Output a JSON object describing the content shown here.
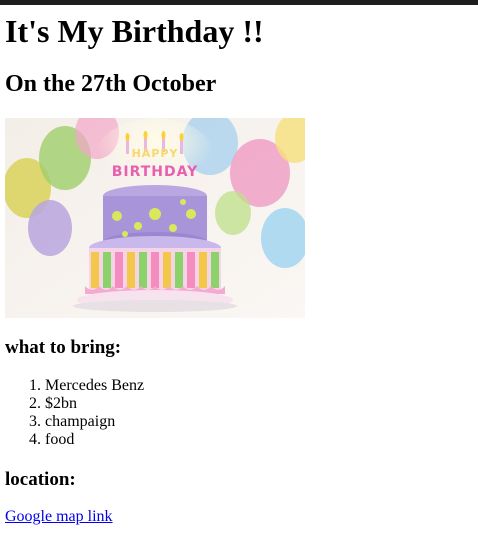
{
  "page": {
    "title": "It's My Birthday !!",
    "subtitle": "On the 27th October",
    "image_alt": "birthday-cake",
    "cake_text": "HAPPY BIRTHDAY"
  },
  "bring": {
    "heading": "what to bring:",
    "items": [
      "Mercedes Benz",
      "$2bn",
      "champaign",
      "food"
    ]
  },
  "location": {
    "heading": "location:",
    "link_text": "Google map link"
  },
  "colors": {
    "top_bar": "#1e1e1e",
    "link": "#0000ee"
  }
}
